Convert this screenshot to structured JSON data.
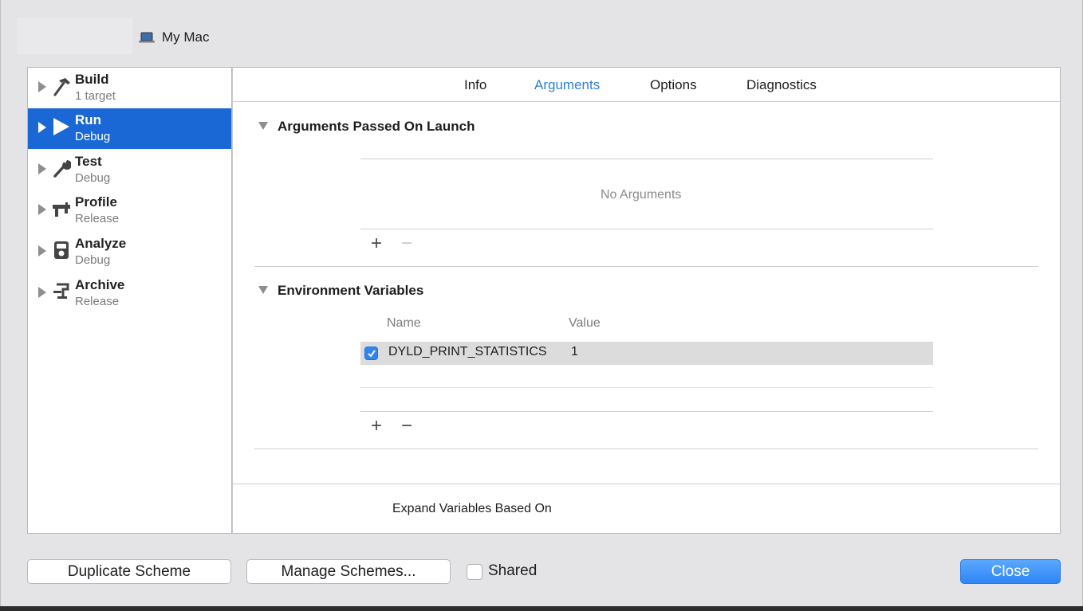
{
  "header": {
    "destination": "My Mac",
    "destination_icon": "laptop-icon"
  },
  "actions": [
    {
      "name": "Build",
      "sub": "1 target",
      "icon": "hammer-icon",
      "selected": false
    },
    {
      "name": "Run",
      "sub": "Debug",
      "icon": "play-icon",
      "selected": true
    },
    {
      "name": "Test",
      "sub": "Debug",
      "icon": "wrench-icon",
      "selected": false
    },
    {
      "name": "Profile",
      "sub": "Release",
      "icon": "caliper-icon",
      "selected": false
    },
    {
      "name": "Analyze",
      "sub": "Debug",
      "icon": "analyze-icon",
      "selected": false
    },
    {
      "name": "Archive",
      "sub": "Release",
      "icon": "archive-icon",
      "selected": false
    }
  ],
  "tabs": [
    {
      "label": "Info",
      "active": false
    },
    {
      "label": "Arguments",
      "active": true
    },
    {
      "label": "Options",
      "active": false
    },
    {
      "label": "Diagnostics",
      "active": false
    }
  ],
  "arguments": {
    "title": "Arguments Passed On Launch",
    "empty_text": "No Arguments",
    "add": "+",
    "remove": "−"
  },
  "environment": {
    "title": "Environment Variables",
    "columns": [
      "Name",
      "Value"
    ],
    "rows": [
      {
        "enabled": true,
        "name": "DYLD_PRINT_STATISTICS",
        "value": "1"
      }
    ],
    "add": "+",
    "remove": "−"
  },
  "expand": {
    "label": "Expand Variables Based On"
  },
  "footer": {
    "duplicate": "Duplicate Scheme",
    "manage": "Manage Schemes...",
    "shared_label": "Shared",
    "shared_checked": false,
    "close": "Close"
  },
  "colors": {
    "selection": "#1a68d6",
    "accent": "#2f7fd6",
    "primary_button": "#2e86f5"
  }
}
